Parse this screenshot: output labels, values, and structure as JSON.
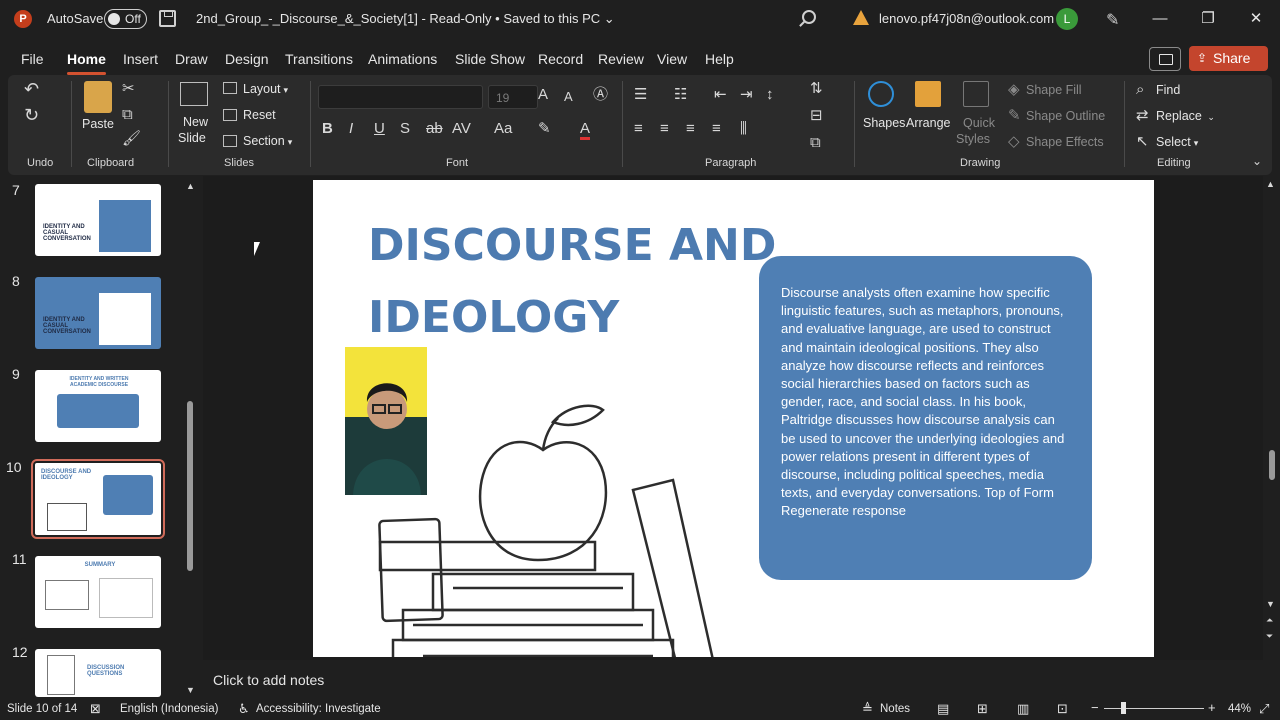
{
  "titlebar": {
    "logo": "P",
    "autosave_label": "AutoSave",
    "autosave_state": "Off",
    "document_title": "2nd_Group_-_Discourse_&_Society[1]  -  Read-Only  •  Saved to this PC ⌄",
    "account_email": "lenovo.pf47j08n@outlook.com",
    "avatar_initial": "L"
  },
  "menu": {
    "tabs": [
      "File",
      "Home",
      "Insert",
      "Draw",
      "Design",
      "Transitions",
      "Animations",
      "Slide Show",
      "Record",
      "Review",
      "View",
      "Help"
    ],
    "active": "Home",
    "share_label": "Share"
  },
  "ribbon": {
    "undo_group": "Undo",
    "clipboard": {
      "label": "Clipboard",
      "paste": "Paste"
    },
    "slides": {
      "label": "Slides",
      "new_slide_1": "New",
      "new_slide_2": "Slide",
      "layout": "Layout",
      "reset": "Reset",
      "section": "Section"
    },
    "font": {
      "label": "Font",
      "font_name": "",
      "font_size": "19"
    },
    "paragraph": {
      "label": "Paragraph"
    },
    "drawing": {
      "label": "Drawing",
      "shapes": "Shapes",
      "arrange": "Arrange",
      "quick_styles_1": "Quick",
      "quick_styles_2": "Styles",
      "shape_fill": "Shape Fill",
      "shape_outline": "Shape Outline",
      "shape_effects": "Shape Effects"
    },
    "editing": {
      "label": "Editing",
      "find": "Find",
      "replace": "Replace",
      "select": "Select"
    }
  },
  "thumbnails": [
    {
      "number": "7",
      "title": "IDENTITY AND CASUAL CONVERSATION"
    },
    {
      "number": "8",
      "title": "IDENTITY AND CASUAL CONVERSATION"
    },
    {
      "number": "9",
      "title": "IDENTITY AND WRITTEN ACADEMIC DISCOURSE"
    },
    {
      "number": "10",
      "title": "DISCOURSE AND IDEOLOGY"
    },
    {
      "number": "11",
      "title": "SUMMARY"
    },
    {
      "number": "12",
      "title": "DISCUSSION QUESTIONS"
    }
  ],
  "slide": {
    "title_line1": "DISCOURSE AND",
    "title_line2": "IDEOLOGY",
    "body": "Discourse analysts often examine how specific linguistic features, such as metaphors, pronouns, and evaluative language, are used to construct and maintain ideological positions. They also analyze how discourse reflects and reinforces social hierarchies based on factors such as gender, race, and social class. In his book, Paltridge discusses how discourse analysis can be used to uncover the underlying ideologies and power relations present in different types of discourse, including political speeches, media texts, and everyday conversations. Top of Form Regenerate response"
  },
  "notes_placeholder": "Click to add notes",
  "status": {
    "slide_indicator": "Slide 10 of 14",
    "language": "English (Indonesia)",
    "accessibility": "Accessibility: Investigate",
    "notes": "Notes",
    "zoom": "44%"
  },
  "colors": {
    "accent": "#d35230",
    "slide_blue": "#4d7bb0",
    "box_blue": "#4f7fb4",
    "share": "#c4452d"
  }
}
